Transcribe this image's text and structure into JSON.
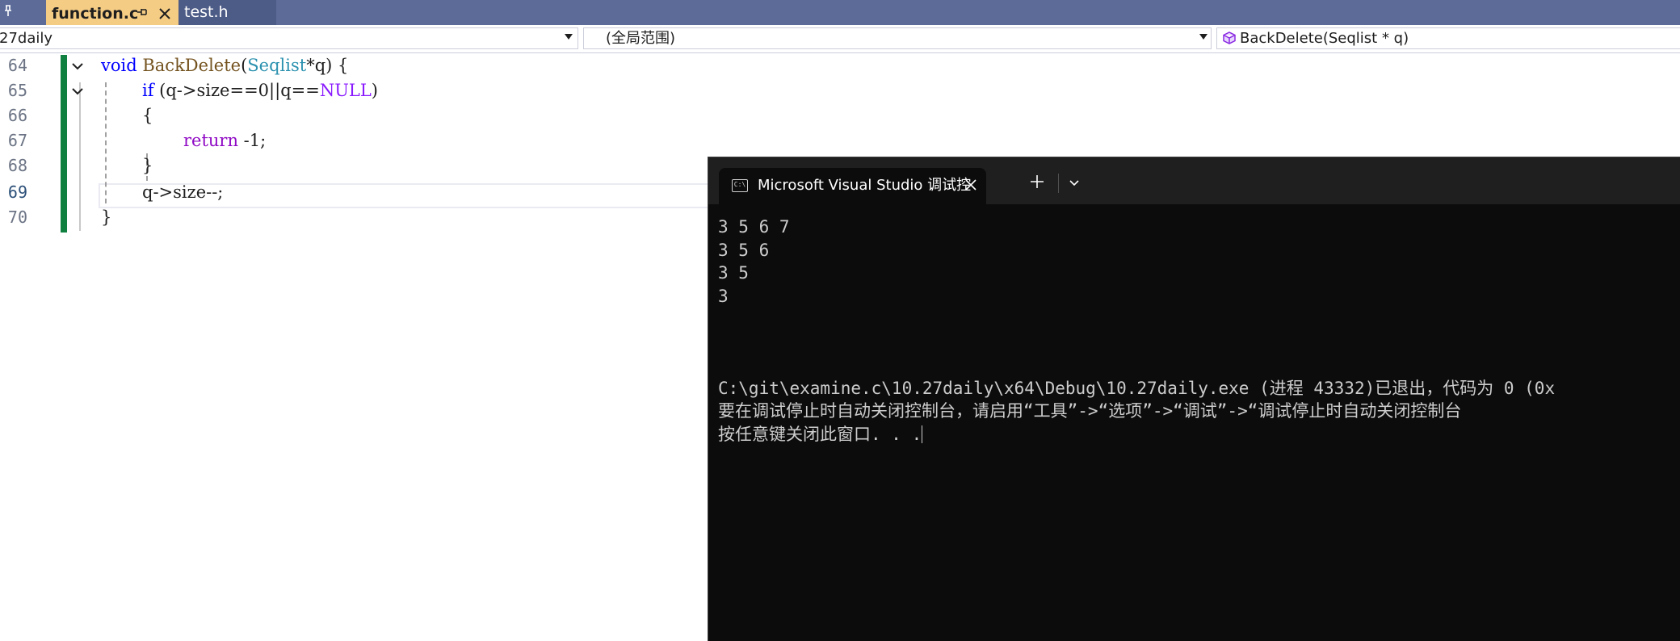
{
  "tabs": {
    "active": {
      "label": "function.c"
    },
    "inactive": {
      "label": "test.h"
    }
  },
  "navbar": {
    "project": "27daily",
    "scope": "(全局范围)",
    "member": "BackDelete(Seqlist * q)"
  },
  "editor": {
    "line_numbers": [
      "64",
      "65",
      "66",
      "67",
      "68",
      "69",
      "70"
    ],
    "current_line": "69",
    "code": {
      "l64": {
        "kw": "void",
        "fn": "BackDelete",
        "p1": "(",
        "ty": "Seqlist",
        "p2": "*q) {"
      },
      "l65": {
        "kw": "if",
        "p1": " (q->size==0||q==",
        "mac": "NULL",
        "p2": ")"
      },
      "l66": {
        "p": "{"
      },
      "l67": {
        "kw": "return",
        "p": " -1;"
      },
      "l68": {
        "p": "}"
      },
      "l69": {
        "p": "q->size--;"
      },
      "l70": {
        "p": "}"
      }
    }
  },
  "console": {
    "title": "Microsoft Visual Studio 调试控",
    "output": [
      "3 5 6 7",
      "3 5 6",
      "3 5",
      "3",
      "",
      "",
      "",
      "C:\\git\\examine.c\\10.27daily\\x64\\Debug\\10.27daily.exe (进程 43332)已退出，代码为 0 (0x",
      "要在调试停止时自动关闭控制台，请启用“工具”->“选项”->“调试”->“调试停止时自动关闭控制台",
      "按任意键关闭此窗口. . ."
    ]
  },
  "colors": {
    "tab_strip": "#5d6b99",
    "active_tab": "#f5cc84",
    "keyword": "#0000ff",
    "control_keyword": "#8f08c4",
    "function": "#74531f",
    "type": "#2b91af",
    "macro": "#8a1bff",
    "change_bar": "#108040",
    "console_bg": "#0c0c0c"
  }
}
